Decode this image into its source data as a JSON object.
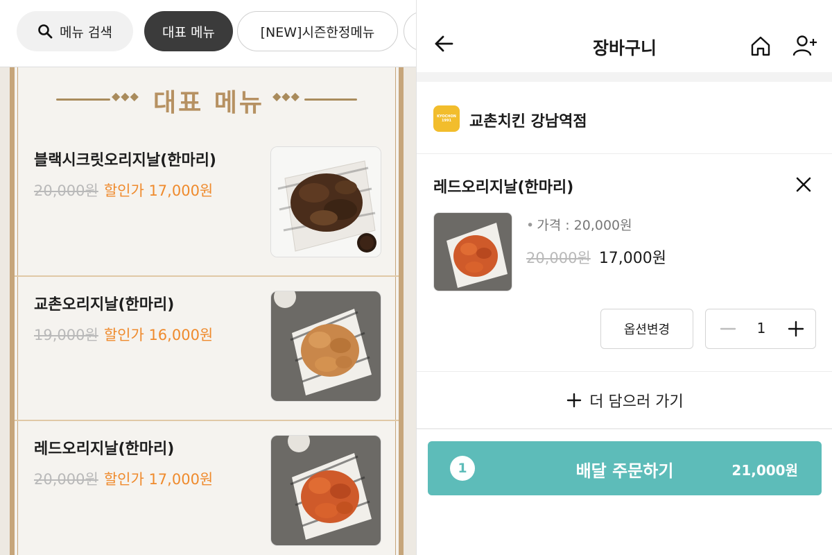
{
  "left": {
    "chips": {
      "search_label": "메뉴 검색",
      "active_label": "대표 메뉴",
      "season_label": "[NEW]시즌한정메뉴"
    },
    "section_title": "대표 메뉴",
    "deco_left": "◆◆◆",
    "deco_right": "◆◆◆",
    "menu_items": [
      {
        "name": "블랙시크릿오리지날(한마리)",
        "original_price": "20,000원",
        "sale_price": "할인가 17,000원"
      },
      {
        "name": "교촌오리지날(한마리)",
        "original_price": "19,000원",
        "sale_price": "할인가 16,000원"
      },
      {
        "name": "레드오리지날(한마리)",
        "original_price": "20,000원",
        "sale_price": "할인가 17,000원"
      }
    ]
  },
  "cart": {
    "title": "장바구니",
    "store": {
      "name": "교촌치킨 강남역점",
      "logo_text_1": "KYOCHON",
      "logo_text_2": "1991"
    },
    "item": {
      "name": "레드오리지날(한마리)",
      "price_info": "가격 : 20,000원",
      "original_price": "20,000원",
      "final_price": "17,000원",
      "option_button": "옵션변경",
      "quantity": "1"
    },
    "add_more_label": "더 담으러 가기",
    "order": {
      "count": "1",
      "label": "배달 주문하기",
      "total": "21,000원"
    }
  },
  "colors": {
    "accent_teal": "#5dbcb9",
    "sale_orange": "#ef8a2c",
    "gold": "#b69162",
    "logo_yellow": "#f2bd2c"
  },
  "icons": [
    "search-icon",
    "back-arrow-icon",
    "home-icon",
    "add-user-icon",
    "close-icon",
    "minus-icon",
    "plus-icon"
  ]
}
